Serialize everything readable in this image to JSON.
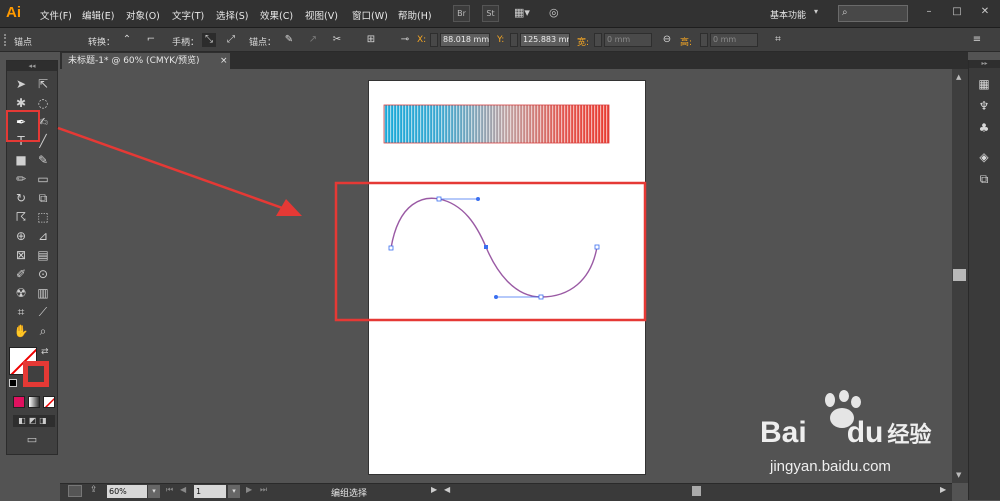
{
  "app": {
    "logo": "Ai"
  },
  "menu": [
    "文件(F)",
    "编辑(E)",
    "对象(O)",
    "文字(T)",
    "选择(S)",
    "效果(C)",
    "视图(V)",
    "窗口(W)",
    "帮助(H)"
  ],
  "menubar_buttons": {
    "br": "Br",
    "st": "St"
  },
  "workspace": "基本功能",
  "control": {
    "anchor_label": "锚点",
    "convert_label": "转换：",
    "handle_label": "手柄：",
    "anchor2_label": "锚点：",
    "x_label": "X:",
    "x_value": "88.018 mm",
    "y_label": "Y:",
    "y_value": "125.883 mm",
    "w_label": "宽:",
    "w_value": "0 mm",
    "h_label": "高:",
    "h_value": "0 mm"
  },
  "document_tab": {
    "title": "未标题-1* @ 60% (CMYK/预览)",
    "close": "×"
  },
  "status": {
    "zoom": "60%",
    "page": "1",
    "selection": "编组选择"
  },
  "watermark": {
    "brand": "Bai",
    "brand_du": "du",
    "brand_cn": "经验",
    "url": "jingyan.baidu.com"
  },
  "colors": {
    "accent": "#ff9a00",
    "highlight": "#e53935",
    "stroke": "#9a5aa4",
    "path": "#3a6ff0"
  }
}
